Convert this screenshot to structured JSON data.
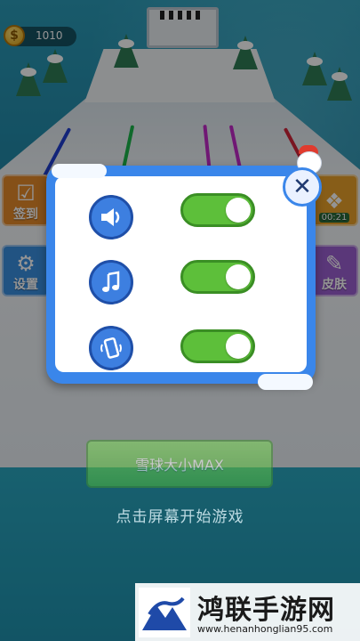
{
  "hud": {
    "coin_symbol": "$",
    "coins": "1010"
  },
  "left_buttons": [
    {
      "label": "签到",
      "icon": "checkbox-icon",
      "color": "#e58a2a"
    },
    {
      "label": "设置",
      "icon": "gear-icon",
      "color": "#3a8fe0"
    }
  ],
  "right_buttons": [
    {
      "timer": "00:21",
      "icon": "gift-icon",
      "color": "#e8a02a"
    },
    {
      "label": "皮肤",
      "icon": "brush-icon",
      "color": "#9b5fd0"
    }
  ],
  "settings_dialog": {
    "rows": [
      {
        "icon": "sound-icon",
        "enabled": true
      },
      {
        "icon": "music-icon",
        "enabled": true
      },
      {
        "icon": "vibration-icon",
        "enabled": true
      }
    ],
    "close_glyph": "✕",
    "accent": "#3a86ea",
    "toggle_color": "#5dbf3a"
  },
  "start_button": {
    "label": "雪球大小MAX"
  },
  "start_hint": "点击屏幕开始游戏",
  "watermark": {
    "title": "鸿联手游网",
    "url": "www.henanhonglian95.com"
  }
}
